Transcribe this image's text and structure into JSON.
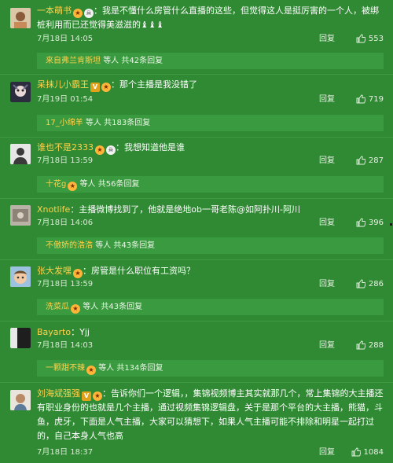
{
  "reply_label": "回复",
  "replies_mid": "等人",
  "comments": [
    {
      "name": "一本萌书",
      "badges": [
        "fire",
        "skull"
      ],
      "text": "：我是不懂什么房管什么直播的这些，但觉得这人是挺厉害的一个人，被绑桩利用而已还觉得美滋滋的",
      "emoji": "♝♝♝",
      "time": "7月18日 14:05",
      "likes": "553",
      "reply_user": "来自弗兰肯斯坦",
      "reply_user_badge": "",
      "reply_count": "共42条回复"
    },
    {
      "name": "呆抹儿小霸王",
      "badges": [
        "vip",
        "fire"
      ],
      "text": "：那个主播是我没错了",
      "emoji": "",
      "time": "7月19日 01:54",
      "likes": "719",
      "reply_user": "17_小绵羊",
      "reply_user_badge": "",
      "reply_count": "共183条回复"
    },
    {
      "name": "谁也不是2333",
      "badges": [
        "fire",
        "skull"
      ],
      "text": "：我想知道他是谁",
      "emoji": "",
      "time": "7月18日 13:59",
      "likes": "287",
      "reply_user": "十花g",
      "reply_user_badge": "fire",
      "reply_count": "共56条回复"
    },
    {
      "name": "Xnotlife",
      "badges": [],
      "text": "：主播微博找到了，他就是绝地ob一哥老陈@如阿扑川-阿川",
      "emoji": "",
      "time": "7月18日 14:06",
      "likes": "396",
      "reply_user": "不傲娇的浩浩",
      "reply_user_badge": "",
      "reply_count": "共43条回复"
    },
    {
      "name": "张大发嘿",
      "badges": [
        "fire"
      ],
      "text": "：房管是什么职位有工资吗？",
      "emoji": "",
      "time": "7月18日 13:59",
      "likes": "286",
      "reply_user": "洗菜瓜",
      "reply_user_badge": "fire",
      "reply_count": "共43条回复"
    },
    {
      "name": "Bayarto",
      "badges": [],
      "text": "：Yjj",
      "emoji": "",
      "time": "7月18日 14:03",
      "likes": "288",
      "reply_user": "一颗甜不辣",
      "reply_user_badge": "fire",
      "reply_count": "共134条回复"
    },
    {
      "name": "刘海斌强强",
      "badges": [
        "v",
        "fire"
      ],
      "text": "：告诉你们一个逻辑，，集锦视频博主其实就那几个，常上集锦的大主播还有职业身份的也就是几个主播，通过视频集锦逻辑盘，关于是那个平台的大主播，熊猫，斗鱼，虎牙，下面是人气主播，大家可以猜想下，如果人气主播可能不排除和明星一起打过的，自己本身人气也高",
      "emoji": "",
      "time": "7月18日 18:37",
      "likes": "1084",
      "reply_user": "",
      "reply_user_badge": "",
      "reply_count": ""
    }
  ]
}
